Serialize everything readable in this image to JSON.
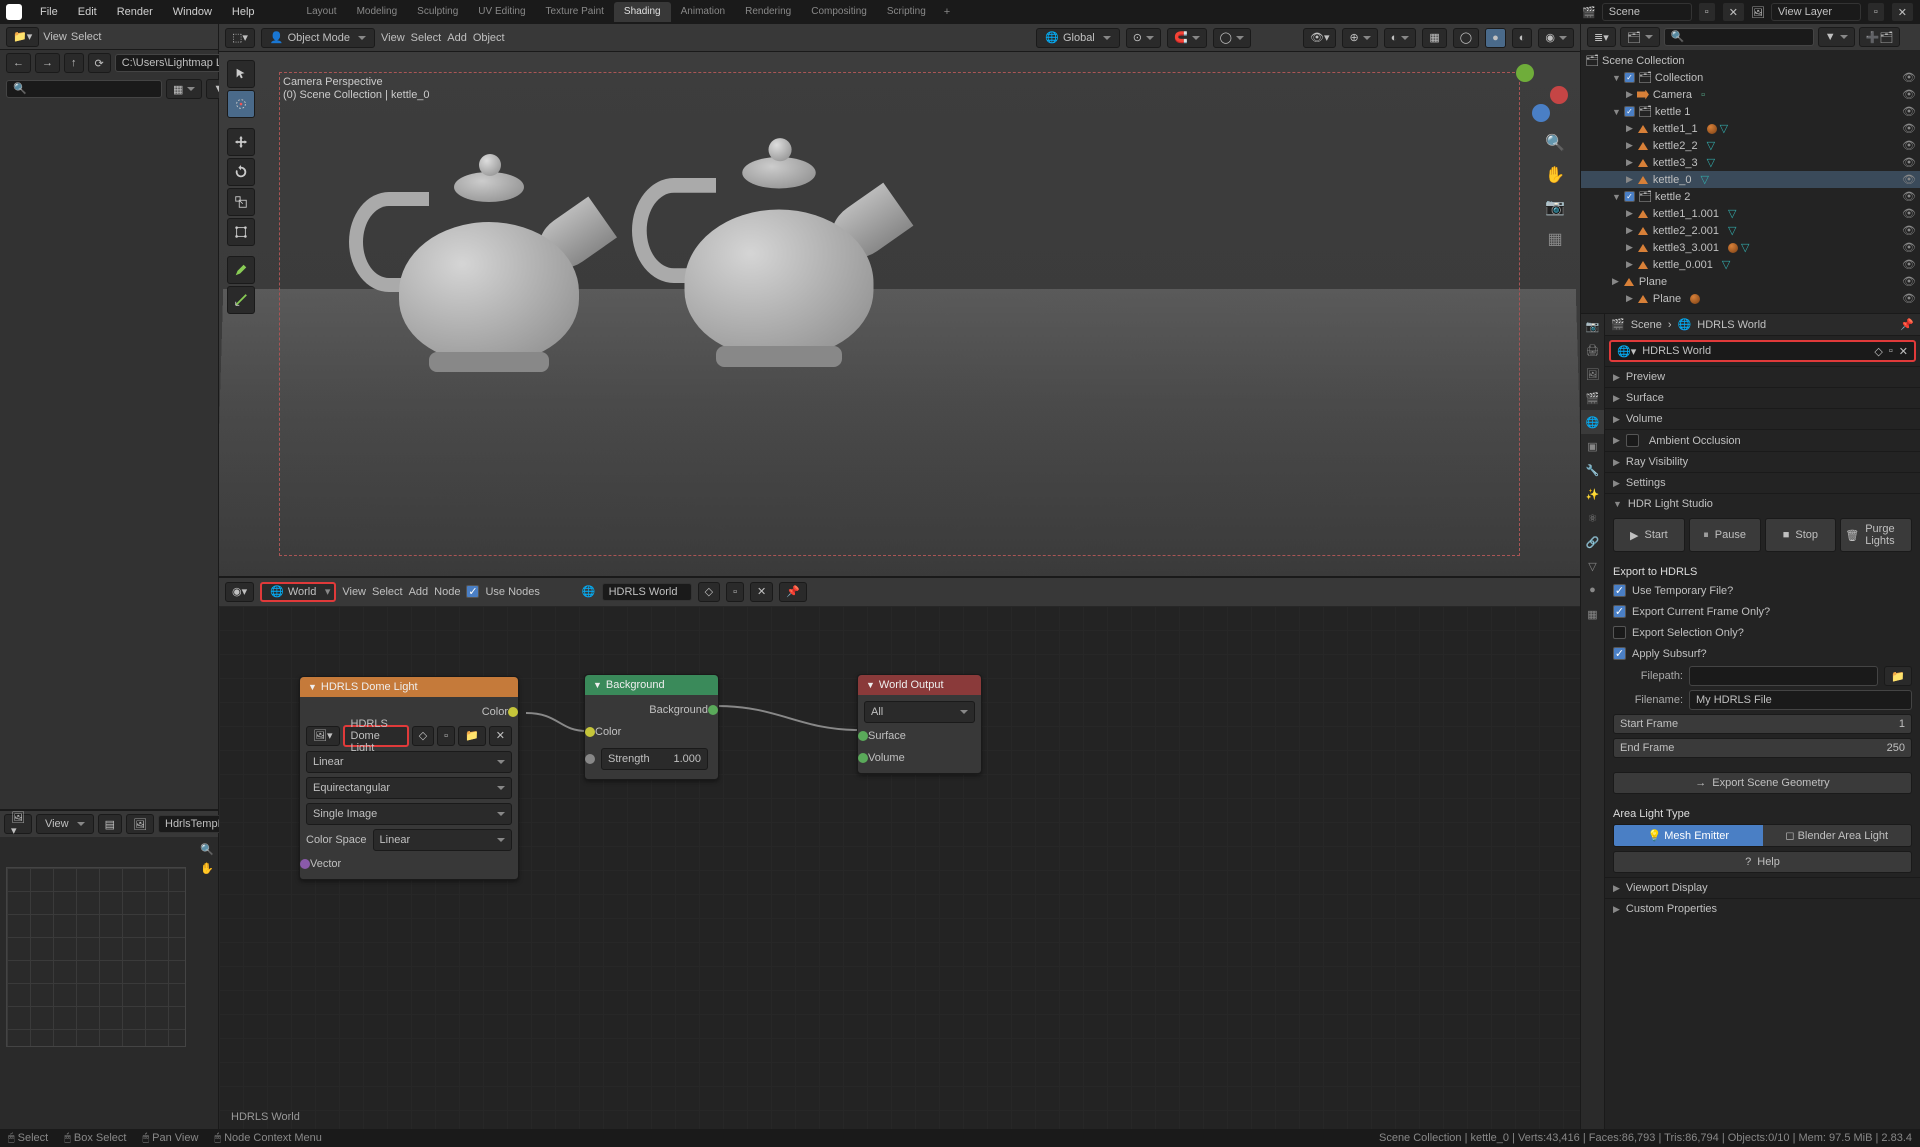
{
  "menubar": {
    "items": [
      "File",
      "Edit",
      "Render",
      "Window",
      "Help"
    ]
  },
  "workspaces": {
    "tabs": [
      "Layout",
      "Modeling",
      "Sculpting",
      "UV Editing",
      "Texture Paint",
      "Shading",
      "Animation",
      "Rendering",
      "Compositing",
      "Scripting"
    ],
    "active": 5
  },
  "scene_switch": {
    "scene": "Scene",
    "view_layer": "View Layer"
  },
  "filebrowser": {
    "view": "View",
    "select": "Select",
    "path": "C:\\Users\\Lightmap Ltd\\",
    "search": ""
  },
  "viewport": {
    "mode": "Object Mode",
    "menus": [
      "View",
      "Select",
      "Add",
      "Object"
    ],
    "orientation": "Global",
    "overlay_title": "Camera Perspective",
    "overlay_sub": "(0) Scene Collection | kettle_0"
  },
  "image_editor": {
    "view": "View",
    "image": "HdrlsTempRawCard."
  },
  "node_editor": {
    "type": "World",
    "menus": [
      "View",
      "Select",
      "Add",
      "Node"
    ],
    "use_nodes": "Use Nodes",
    "world": "HDRLS World",
    "footer": "HDRLS World",
    "nodes": {
      "dome": {
        "title": "HDRLS Dome Light",
        "out_color": "Color",
        "image": "HDRLS Dome Light",
        "interp": "Linear",
        "projection": "Equirectangular",
        "source": "Single Image",
        "colorspace_label": "Color Space",
        "colorspace": "Linear",
        "vector": "Vector"
      },
      "bg": {
        "title": "Background",
        "out": "Background",
        "color": "Color",
        "strength_label": "Strength",
        "strength": "1.000"
      },
      "out": {
        "title": "World Output",
        "target": "All",
        "surface": "Surface",
        "volume": "Volume"
      }
    }
  },
  "outliner": {
    "root": "Scene Collection",
    "items": [
      {
        "type": "collection",
        "name": "Collection",
        "depth": 1,
        "open": true
      },
      {
        "type": "camera",
        "name": "Camera",
        "depth": 2
      },
      {
        "type": "collection",
        "name": "kettle 1",
        "depth": 1,
        "open": true
      },
      {
        "type": "mesh",
        "name": "kettle1_1",
        "depth": 2,
        "mat": true,
        "data": true
      },
      {
        "type": "mesh",
        "name": "kettle2_2",
        "depth": 2,
        "data": true
      },
      {
        "type": "mesh",
        "name": "kettle3_3",
        "depth": 2,
        "data": true
      },
      {
        "type": "mesh",
        "name": "kettle_0",
        "depth": 2,
        "data": true,
        "selected": true
      },
      {
        "type": "collection",
        "name": "kettle 2",
        "depth": 1,
        "open": true
      },
      {
        "type": "mesh",
        "name": "kettle1_1.001",
        "depth": 2,
        "data": true
      },
      {
        "type": "mesh",
        "name": "kettle2_2.001",
        "depth": 2,
        "data": true
      },
      {
        "type": "mesh",
        "name": "kettle3_3.001",
        "depth": 2,
        "mat": true,
        "data": true
      },
      {
        "type": "mesh",
        "name": "kettle_0.001",
        "depth": 2,
        "data": true
      },
      {
        "type": "mesh",
        "name": "Plane",
        "depth": 1
      },
      {
        "type": "mesh",
        "name": "Plane",
        "depth": 2,
        "mat": true
      }
    ]
  },
  "properties": {
    "breadcrumb": {
      "scene": "Scene",
      "world": "HDRLS World"
    },
    "world_field": "HDRLS World",
    "panels_collapsed": [
      "Preview",
      "Surface",
      "Volume",
      "Ambient Occlusion",
      "Ray Visibility",
      "Settings"
    ],
    "hdrls": {
      "title": "HDR Light Studio",
      "start": "Start",
      "pause": "Pause",
      "stop": "Stop",
      "purge": "Purge Lights",
      "export_title": "Export to HDRLS",
      "use_temp": "Use Temporary File?",
      "curr_frame": "Export Current Frame Only?",
      "sel_only": "Export Selection Only?",
      "subsurf": "Apply Subsurf?",
      "filepath_label": "Filepath:",
      "filepath": "",
      "filename_label": "Filename:",
      "filename": "My HDRLS File",
      "start_frame_label": "Start Frame",
      "start_frame": "1",
      "end_frame_label": "End Frame",
      "end_frame": "250",
      "export_geom": "Export Scene Geometry",
      "area_title": "Area Light Type",
      "mesh_emitter": "Mesh Emitter",
      "blender_area": "Blender Area Light",
      "help": "Help"
    },
    "panels_after": [
      "Viewport Display",
      "Custom Properties"
    ]
  },
  "status": {
    "left": [
      {
        "icon": "mouse",
        "text": "Select"
      },
      {
        "icon": "mouse",
        "text": "Box Select"
      },
      {
        "icon": "mouse",
        "text": "Pan View"
      },
      {
        "icon": "mouse",
        "text": "Node Context Menu"
      }
    ],
    "right": "Scene Collection | kettle_0 | Verts:43,416 | Faces:86,793 | Tris:86,794 | Objects:0/10 | Mem: 97.5 MiB | 2.83.4"
  }
}
